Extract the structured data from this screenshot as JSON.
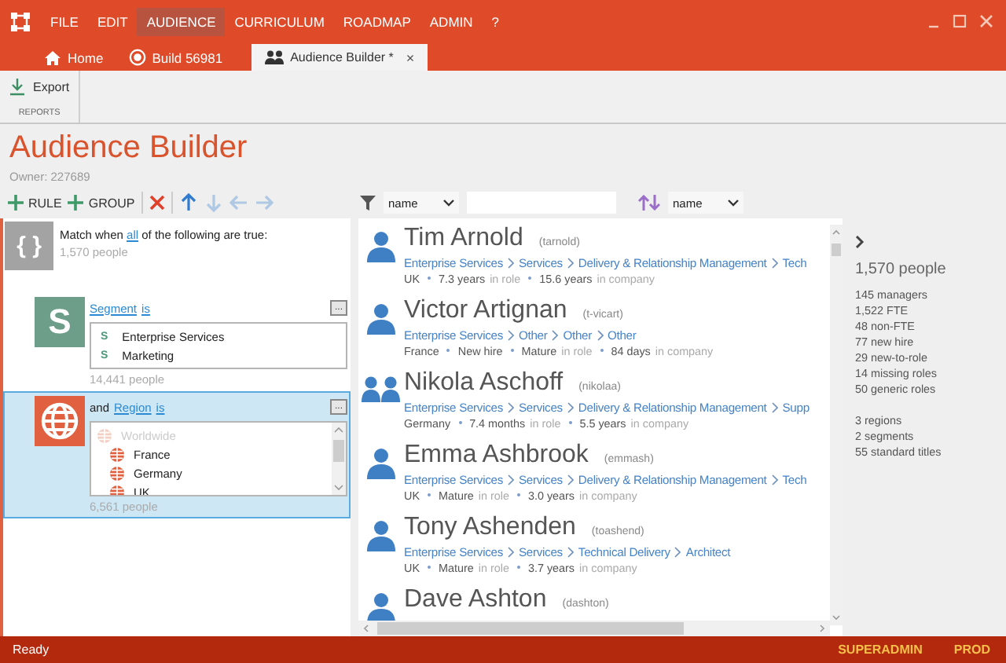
{
  "menu": [
    {
      "label": "FILE",
      "selected": false
    },
    {
      "label": "EDIT",
      "selected": false
    },
    {
      "label": "AUDIENCE",
      "selected": true
    },
    {
      "label": "CURRICULUM",
      "selected": false
    },
    {
      "label": "ROADMAP",
      "selected": false
    },
    {
      "label": "ADMIN",
      "selected": false
    },
    {
      "label": "?",
      "selected": false
    }
  ],
  "tabs": [
    {
      "label": "Home",
      "kind": "home",
      "selected": false
    },
    {
      "label": "Build 56981",
      "kind": "build",
      "selected": false
    },
    {
      "label": "Audience Builder *",
      "kind": "audience",
      "selected": true,
      "close": "×"
    }
  ],
  "ribbon": {
    "button": "Export",
    "group": "REPORTS"
  },
  "page": {
    "title": "Audience Builder",
    "owner": "Owner: 227689"
  },
  "toolbar": [
    {
      "kind": "add",
      "label": "RULE",
      "disabled": false
    },
    {
      "kind": "add",
      "label": "GROUP",
      "disabled": false
    },
    {
      "kind": "delete",
      "disabled": false
    },
    {
      "kind": "up",
      "disabled": false
    },
    {
      "kind": "down",
      "disabled": true
    },
    {
      "kind": "left",
      "disabled": true
    },
    {
      "kind": "right",
      "disabled": true
    }
  ],
  "filter": {
    "field": "name"
  },
  "sort": {
    "field": "name"
  },
  "group": {
    "glyph": "{ }",
    "before": "Match when",
    "link": "all",
    "after": "of the following are true:",
    "count": "1,570 people"
  },
  "rules": [
    {
      "kind": "segment",
      "glyph": "S",
      "color": "#6c9e8a",
      "field": "Segment",
      "op": "is",
      "more": "...",
      "selected": false,
      "count": "14,441 people",
      "values": [
        {
          "label": "Enterprise Services",
          "glyph": "S",
          "disabled": false
        },
        {
          "label": "Marketing",
          "glyph": "S",
          "disabled": false
        }
      ]
    },
    {
      "kind": "region",
      "color": "#e0603f",
      "prefix": "and",
      "field": "Region",
      "op": "is",
      "more": "...",
      "selected": true,
      "count": "6,561 people",
      "values": [
        {
          "label": "Worldwide",
          "disabled": true
        },
        {
          "label": "France",
          "disabled": false
        },
        {
          "label": "Germany",
          "disabled": false
        },
        {
          "label": "UK",
          "disabled": false
        }
      ]
    }
  ],
  "people": [
    {
      "name": "Tim Arnold",
      "handle": "(tarnold)",
      "kind": "person",
      "path": [
        "Enterprise Services",
        "Services",
        "Delivery & Relationship Management",
        "Tech"
      ],
      "details": [
        {
          "value": "UK"
        },
        {
          "value": "7.3 years",
          "suffix": "in role"
        },
        {
          "value": "15.6 years",
          "suffix": "in company"
        }
      ]
    },
    {
      "name": "Victor Artignan",
      "handle": "(t-vicart)",
      "kind": "person",
      "path": [
        "Enterprise Services",
        "Other",
        "Other",
        "Other"
      ],
      "details": [
        {
          "value": "France"
        },
        {
          "value": "New hire"
        },
        {
          "value": "Mature",
          "suffix": "in role"
        },
        {
          "value": "84 days",
          "suffix": "in company"
        }
      ]
    },
    {
      "name": "Nikola Aschoff",
      "handle": "(nikolaa)",
      "kind": "manager",
      "path": [
        "Enterprise Services",
        "Services",
        "Delivery & Relationship Management",
        "Supp"
      ],
      "details": [
        {
          "value": "Germany"
        },
        {
          "value": "7.4 months",
          "suffix": "in role"
        },
        {
          "value": "5.5 years",
          "suffix": "in company"
        }
      ]
    },
    {
      "name": "Emma Ashbrook",
      "handle": "(emmash)",
      "kind": "person",
      "path": [
        "Enterprise Services",
        "Services",
        "Delivery & Relationship Management",
        "Tech"
      ],
      "details": [
        {
          "value": "UK"
        },
        {
          "value": "Mature",
          "suffix": "in role"
        },
        {
          "value": "3.0 years",
          "suffix": "in company"
        }
      ]
    },
    {
      "name": "Tony Ashenden",
      "handle": "(toashend)",
      "kind": "person",
      "path": [
        "Enterprise Services",
        "Services",
        "Technical Delivery",
        "Architect"
      ],
      "details": [
        {
          "value": "UK"
        },
        {
          "value": "Mature",
          "suffix": "in role"
        },
        {
          "value": "3.7 years",
          "suffix": "in company"
        }
      ]
    },
    {
      "name": "Dave Ashton",
      "handle": "(dashton)",
      "kind": "person"
    }
  ],
  "stats": {
    "total": "1,570 people",
    "groups": [
      [
        "145 managers",
        "1,522 FTE",
        "48 non-FTE",
        "77 new hire",
        "29 new-to-role",
        "14 missing roles",
        "50 generic roles"
      ],
      [
        "3 regions",
        "2 segments",
        "55 standard titles"
      ]
    ]
  },
  "status": {
    "text": "Ready",
    "user": "SUPERADMIN",
    "env": "PROD"
  }
}
